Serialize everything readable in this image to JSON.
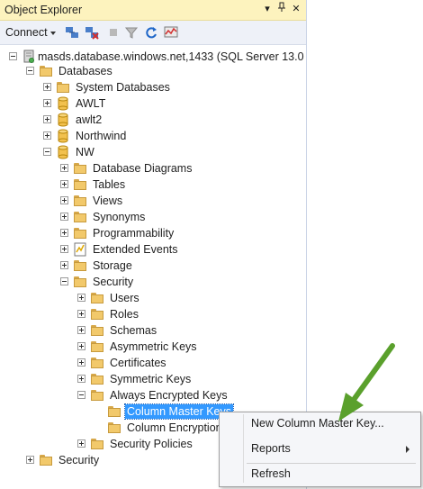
{
  "panel": {
    "title": "Object Explorer"
  },
  "titlebar": {
    "dropdown_icon": "chevron-down-icon",
    "pin_icon": "pin-icon",
    "close_icon": "close-icon"
  },
  "toolbar": {
    "connect_label": "Connect",
    "icons": [
      "connect-object-icon",
      "disconnect-icon",
      "stop-icon",
      "filter-icon",
      "refresh-icon",
      "activity-monitor-icon"
    ]
  },
  "tree": {
    "server": "masds.database.windows.net,1433 (SQL Server 13.0",
    "databases": "Databases",
    "system_databases": "System Databases",
    "awlt": "AWLT",
    "awlt2": "awlt2",
    "northwind": "Northwind",
    "nw": "NW",
    "database_diagrams": "Database Diagrams",
    "tables": "Tables",
    "views": "Views",
    "synonyms": "Synonyms",
    "programmability": "Programmability",
    "extended_events": "Extended Events",
    "storage": "Storage",
    "security": "Security",
    "users": "Users",
    "roles": "Roles",
    "schemas": "Schemas",
    "asymmetric_keys": "Asymmetric Keys",
    "certificates": "Certificates",
    "symmetric_keys": "Symmetric Keys",
    "always_encrypted_keys": "Always Encrypted Keys",
    "column_master_keys": "Column Master Keys",
    "column_encryption_keys": "Column Encryption",
    "security_policies": "Security Policies",
    "server_security": "Security"
  },
  "context_menu": {
    "new_cmk": "New Column Master Key...",
    "reports": "Reports",
    "refresh": "Refresh"
  },
  "colors": {
    "selection": "#3399ff",
    "titlebar": "#fdf3be",
    "annotation_arrow": "#5aa02c"
  }
}
